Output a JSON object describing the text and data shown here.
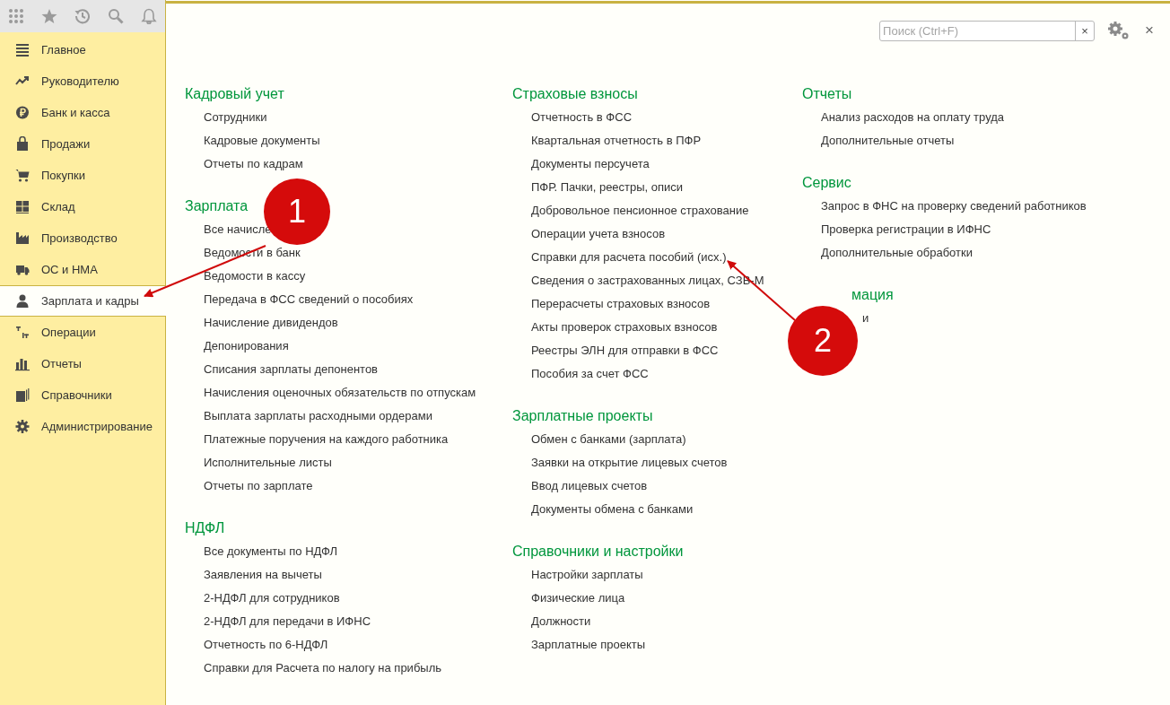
{
  "sidebar": {
    "items": [
      {
        "label": "Главное",
        "selected": false
      },
      {
        "label": "Руководителю",
        "selected": false
      },
      {
        "label": "Банк и касса",
        "selected": false
      },
      {
        "label": "Продажи",
        "selected": false
      },
      {
        "label": "Покупки",
        "selected": false
      },
      {
        "label": "Склад",
        "selected": false
      },
      {
        "label": "Производство",
        "selected": false
      },
      {
        "label": "ОС и НМА",
        "selected": false
      },
      {
        "label": "Зарплата и кадры",
        "selected": true
      },
      {
        "label": "Операции",
        "selected": false
      },
      {
        "label": "Отчеты",
        "selected": false
      },
      {
        "label": "Справочники",
        "selected": false
      },
      {
        "label": "Администрирование",
        "selected": false
      }
    ]
  },
  "search": {
    "placeholder": "Поиск (Ctrl+F)",
    "clear": "×"
  },
  "close": "×",
  "columns": [
    [
      {
        "title": "Кадровый учет",
        "items": [
          "Сотрудники",
          "Кадровые документы",
          "Отчеты по кадрам"
        ]
      },
      {
        "title": "Зарплата",
        "items": [
          "Все начисле",
          "Ведомости в банк",
          "Ведомости в кассу",
          "Передача в ФСС сведений о пособиях",
          "Начисление дивидендов",
          "Депонирования",
          "Списания зарплаты депонентов",
          "Начисления оценочных обязательств по отпускам",
          "Выплата зарплаты расходными ордерами",
          "Платежные поручения на каждого работника",
          "Исполнительные листы",
          "Отчеты по зарплате"
        ]
      },
      {
        "title": "НДФЛ",
        "items": [
          "Все документы по НДФЛ",
          "Заявления на вычеты",
          "2-НДФЛ для сотрудников",
          "2-НДФЛ для передачи в ИФНС",
          "Отчетность по 6-НДФЛ",
          "Справки для Расчета по налогу на прибыль"
        ]
      }
    ],
    [
      {
        "title": "Страховые взносы",
        "items": [
          "Отчетность в ФСС",
          "Квартальная отчетность в ПФР",
          "Документы персучета",
          "ПФР. Пачки, реестры, описи",
          "Добровольное пенсионное страхование",
          "Операции учета взносов",
          "Справки для расчета пособий (исх.)",
          "Сведения о застрахованных лицах, СЗВ-М",
          "Перерасчеты страховых взносов",
          "Акты проверок страховых взносов",
          "Реестры ЭЛН для отправки в ФСС",
          "Пособия за счет ФСС"
        ]
      },
      {
        "title": "Зарплатные проекты",
        "items": [
          "Обмен с банками (зарплата)",
          "Заявки на открытие лицевых счетов",
          "Ввод лицевых счетов",
          "Документы обмена с банками"
        ]
      },
      {
        "title": "Справочники и настройки",
        "items": [
          "Настройки зарплаты",
          "Физические лица",
          "Должности",
          "Зарплатные проекты"
        ]
      }
    ],
    [
      {
        "title": "Отчеты",
        "items": [
          "Анализ расходов на оплату труда",
          "Дополнительные отчеты"
        ]
      },
      {
        "title": "Сервис",
        "items": [
          "Запрос в ФНС на проверку сведений работников",
          "Проверка регистрации в ИФНС",
          "Дополнительные обработки"
        ]
      },
      {
        "title": "мация",
        "items": [
          "и"
        ],
        "kind": "covered"
      }
    ]
  ],
  "annotations": [
    {
      "number": "1"
    },
    {
      "number": "2"
    }
  ]
}
